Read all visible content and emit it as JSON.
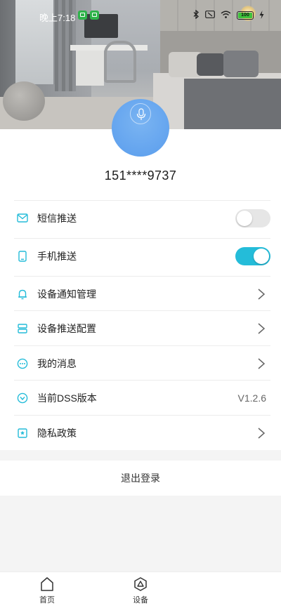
{
  "status_bar": {
    "time": "晚上7:18",
    "battery": "100",
    "bluetooth_icon": "bluetooth-icon",
    "wifi_icon": "wifi-icon"
  },
  "profile": {
    "avatar_icon": "microphone-icon",
    "phone": "151****9737"
  },
  "menu": [
    {
      "label": "短信推送",
      "icon": "envelope-icon",
      "control": "toggle",
      "state": "off"
    },
    {
      "label": "手机推送",
      "icon": "phone-icon",
      "control": "toggle",
      "state": "on"
    },
    {
      "label": "设备通知管理",
      "icon": "bell-icon",
      "control": "chevron"
    },
    {
      "label": "设备推送配置",
      "icon": "server-icon",
      "control": "chevron"
    },
    {
      "label": "我的消息",
      "icon": "message-icon",
      "control": "chevron"
    },
    {
      "label": "当前DSS版本",
      "icon": "version-icon",
      "control": "value",
      "value": "V1.2.6"
    },
    {
      "label": "隐私政策",
      "icon": "privacy-icon",
      "control": "chevron"
    }
  ],
  "logout_label": "退出登录",
  "tabs": [
    {
      "label": "首页",
      "icon": "home-icon"
    },
    {
      "label": "设备",
      "icon": "device-icon"
    }
  ],
  "colors": {
    "accent": "#24bcd9",
    "avatar": "#5a9ded",
    "status_badge": "#2fb34a"
  }
}
